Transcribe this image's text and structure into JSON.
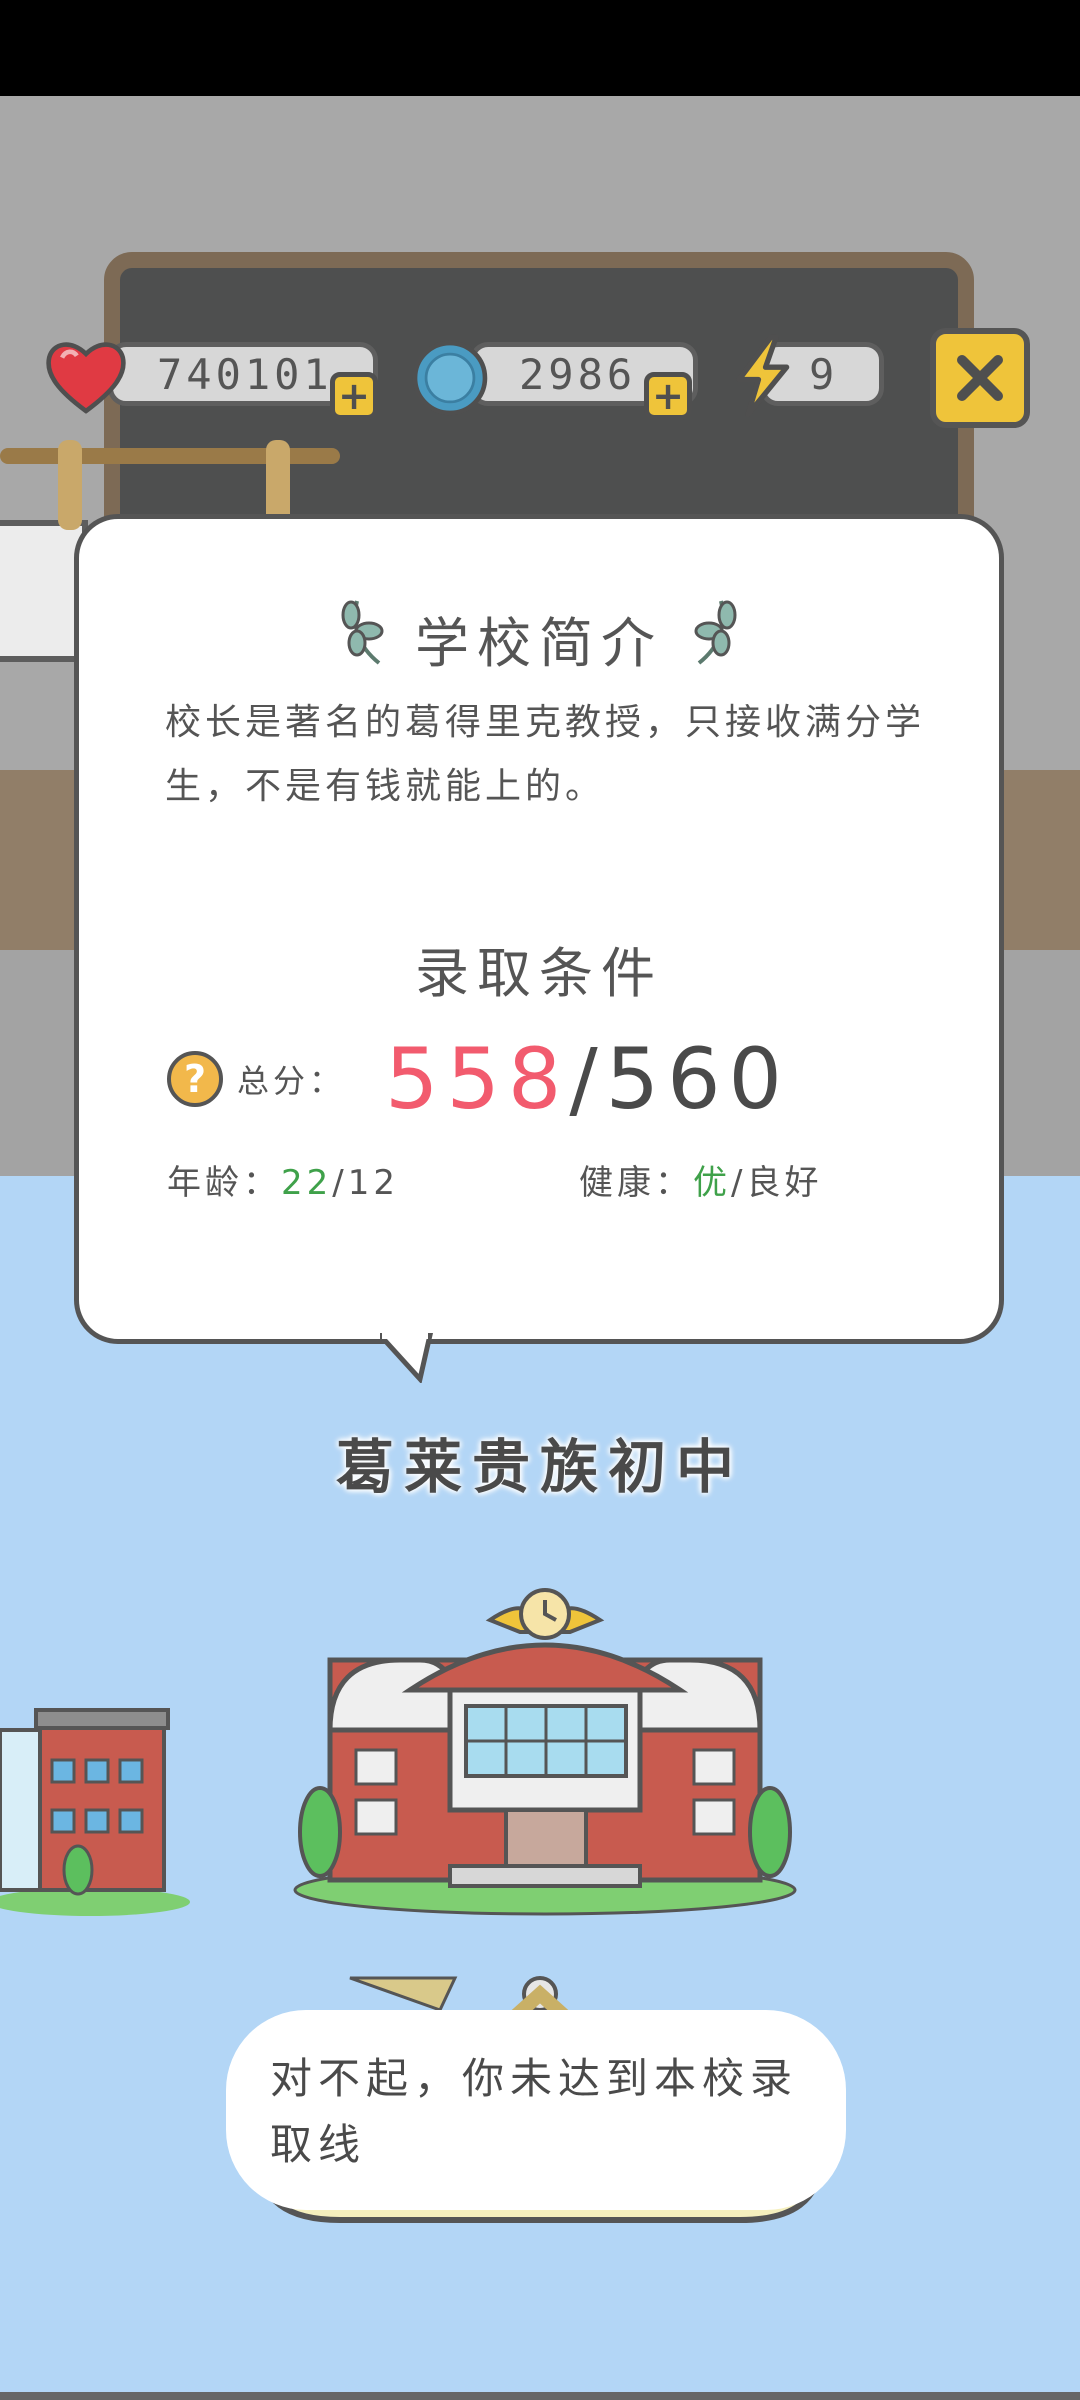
{
  "hud": {
    "hearts_value": "740101",
    "coins_value": "2986",
    "energy_value": "9",
    "plus_label": "+",
    "close_label": "✕"
  },
  "card": {
    "title": "学校简介",
    "description": "校长是著名的葛得里克教授，只接收满分学生，不是有钱就能上的。",
    "requirements_title": "录取条件",
    "score_help": "?",
    "score_label": "总分：",
    "score_current": "558",
    "score_separator": "/",
    "score_required": "560",
    "age_label": "年龄：",
    "age_current": "22",
    "age_required": "/12",
    "health_label": "健康：",
    "health_current": "优",
    "health_required": "/良好"
  },
  "school": {
    "name": "葛莱贵族初中"
  },
  "message": {
    "text": "对不起，你未达到本校录取线"
  },
  "colors": {
    "accent_yellow": "#efc43a",
    "score_red": "#f25b6e",
    "ok_green": "#3fa14a",
    "sky_blue": "#b3d6f6"
  }
}
